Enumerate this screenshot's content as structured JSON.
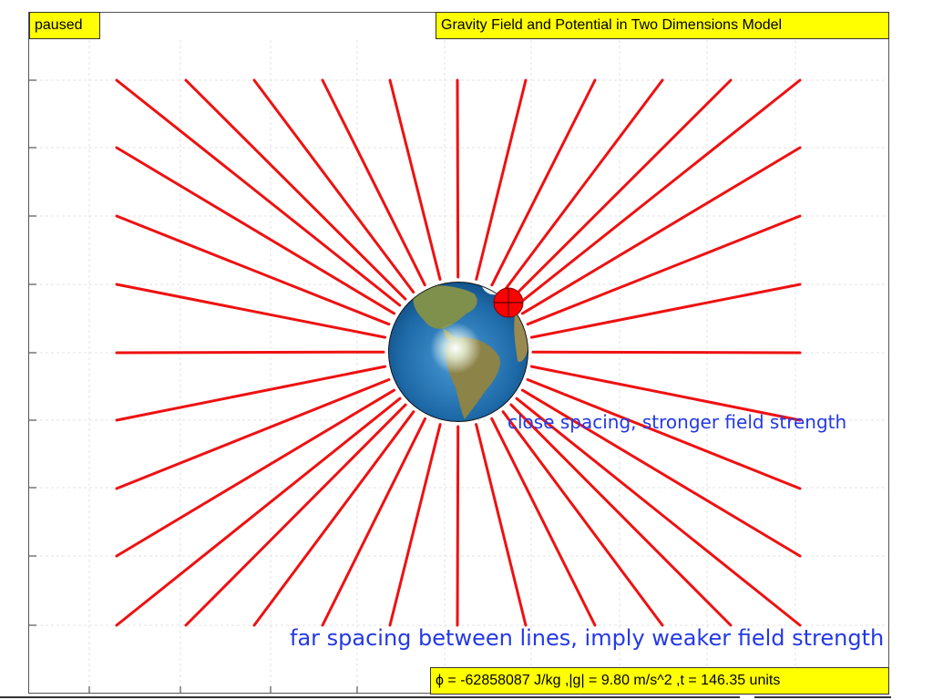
{
  "status": {
    "label": "paused"
  },
  "title": {
    "text": "Gravity Field and Potential in Two Dimensions Model"
  },
  "readout": {
    "text": "ϕ = -62858087 J/kg ,|g| = 9.80 m/s^2 ,t = 146.35 units"
  },
  "annotations": {
    "close": "close spacing, stronger field strength",
    "far": "far spacing between lines, imply weaker field strength"
  },
  "colors": {
    "field_line": "#ee1111",
    "label_bg": "#ffff00",
    "annotation": "#2439e6",
    "planet_ocean": "#1e6aa8",
    "probe": "#ff0000"
  },
  "icons": {
    "planet": "earth-icon",
    "probe": "test-mass-icon"
  }
}
